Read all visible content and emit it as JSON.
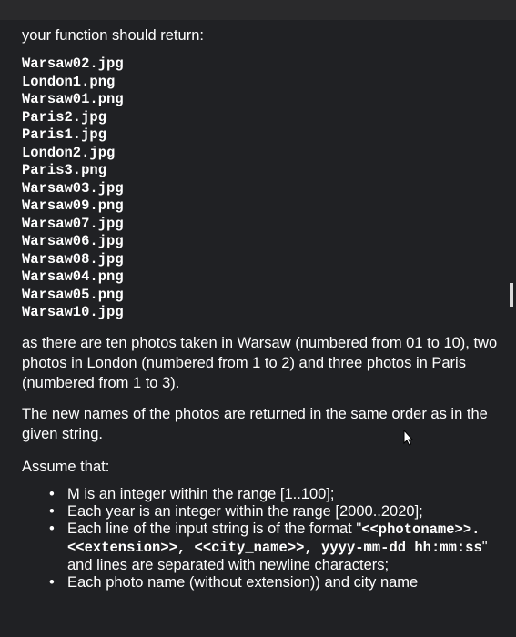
{
  "intro": "your function should return:",
  "files": [
    "Warsaw02.jpg",
    "London1.png",
    "Warsaw01.png",
    "Paris2.jpg",
    "Paris1.jpg",
    "London2.jpg",
    "Paris3.png",
    "Warsaw03.jpg",
    "Warsaw09.png",
    "Warsaw07.jpg",
    "Warsaw06.jpg",
    "Warsaw08.jpg",
    "Warsaw04.png",
    "Warsaw05.png",
    "Warsaw10.jpg"
  ],
  "explanation": "as there are ten photos taken in Warsaw (numbered from 01 to 10), two photos in London (numbered from 1 to 2) and three photos in Paris (numbered from 1 to 3).",
  "order_note": "The new names of the photos are returned in the same order as in the given string.",
  "assume_heading": "Assume that:",
  "bullets": {
    "b1": "M is an integer within the range [1..100];",
    "b2": "Each year is an integer within the range [2000..2020];",
    "b3_prefix": "Each line of the input string is of the format \"",
    "b3_code1": "<<photoname>>.<<extension>>, <<city_name>>, yyyy-mm-dd hh:mm:ss",
    "b3_suffix": "\" and lines are separated with newline characters;",
    "b4": "Each photo name (without extension)) and city name"
  },
  "icons": {
    "cursor": "mouse-pointer-icon"
  }
}
